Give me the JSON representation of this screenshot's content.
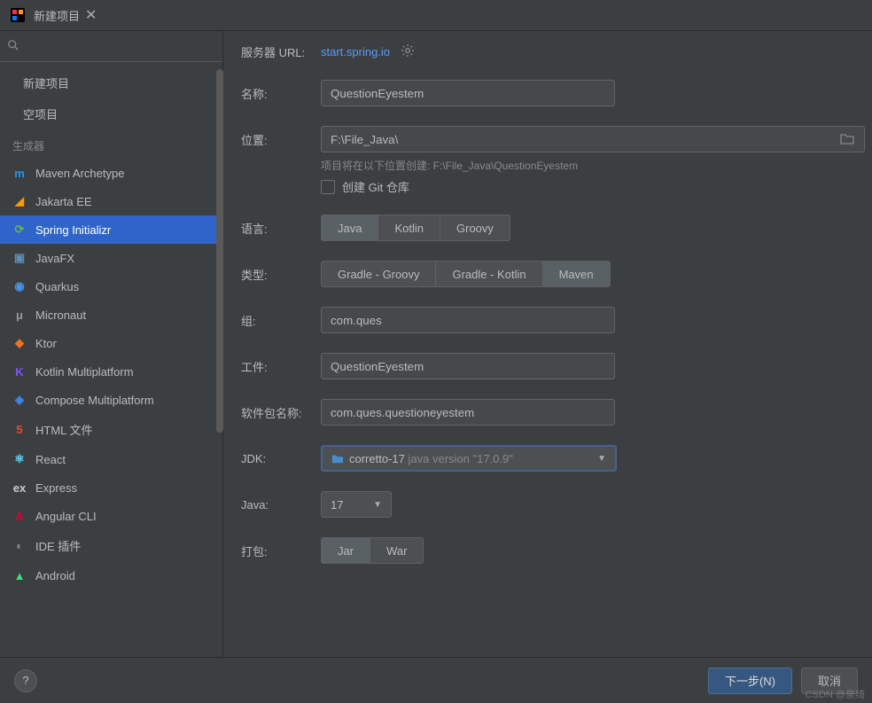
{
  "titlebar": {
    "title": "新建项目"
  },
  "sidebar": {
    "search_placeholder": "",
    "items": [
      {
        "label": "新建项目",
        "key": "new-project"
      },
      {
        "label": "空项目",
        "key": "empty-project"
      }
    ],
    "section_label": "生成器",
    "generators": [
      {
        "label": "Maven Archetype",
        "key": "maven-archetype",
        "color": "#2196f3",
        "letter": "m"
      },
      {
        "label": "Jakarta EE",
        "key": "jakarta-ee",
        "color": "#ff9800",
        "letter": "◢"
      },
      {
        "label": "Spring Initializr",
        "key": "spring-initializr",
        "color": "#6db33f",
        "letter": "⟳",
        "selected": true
      },
      {
        "label": "JavaFX",
        "key": "javafx",
        "color": "#5b8fb9",
        "letter": "▣"
      },
      {
        "label": "Quarkus",
        "key": "quarkus",
        "color": "#4695eb",
        "letter": "◉"
      },
      {
        "label": "Micronaut",
        "key": "micronaut",
        "color": "#999",
        "letter": "μ"
      },
      {
        "label": "Ktor",
        "key": "ktor",
        "color": "#f36f21",
        "letter": "◆"
      },
      {
        "label": "Kotlin Multiplatform",
        "key": "kotlin-mp",
        "color": "#7f52ff",
        "letter": "K"
      },
      {
        "label": "Compose Multiplatform",
        "key": "compose-mp",
        "color": "#4285f4",
        "letter": "◈"
      },
      {
        "label": "HTML 文件",
        "key": "html",
        "color": "#e44d26",
        "letter": "5"
      },
      {
        "label": "React",
        "key": "react",
        "color": "#61dafb",
        "letter": "⚛"
      },
      {
        "label": "Express",
        "key": "express",
        "color": "#ccc",
        "letter": "ex"
      },
      {
        "label": "Angular CLI",
        "key": "angular",
        "color": "#dd0031",
        "letter": "A"
      },
      {
        "label": "IDE 插件",
        "key": "ide-plugin",
        "color": "#888",
        "letter": "◐"
      },
      {
        "label": "Android",
        "key": "android",
        "color": "#3ddc84",
        "letter": "▲"
      }
    ]
  },
  "form": {
    "server_url_label": "服务器 URL:",
    "server_url": "start.spring.io",
    "name_label": "名称:",
    "name_value": "QuestionEyestem",
    "location_label": "位置:",
    "location_value": "F:\\File_Java\\",
    "location_hint": "项目将在以下位置创建: F:\\File_Java\\QuestionEyestem",
    "git_checkbox_label": "创建 Git 仓库",
    "language_label": "语言:",
    "languages": [
      "Java",
      "Kotlin",
      "Groovy"
    ],
    "language_selected": "Java",
    "type_label": "类型:",
    "types": [
      "Gradle - Groovy",
      "Gradle - Kotlin",
      "Maven"
    ],
    "type_selected": "Maven",
    "group_label": "组:",
    "group_value": "com.ques",
    "artifact_label": "工件:",
    "artifact_value": "QuestionEyestem",
    "package_label": "软件包名称:",
    "package_value": "com.ques.questioneyestem",
    "jdk_label": "JDK:",
    "jdk_value": "corretto-17",
    "jdk_version": "java version \"17.0.9\"",
    "java_label": "Java:",
    "java_value": "17",
    "packaging_label": "打包:",
    "packagings": [
      "Jar",
      "War"
    ],
    "packaging_selected": "Jar"
  },
  "footer": {
    "next_label": "下一步(N)",
    "cancel_label": "取消"
  },
  "watermark": "CSDN @泉绮"
}
